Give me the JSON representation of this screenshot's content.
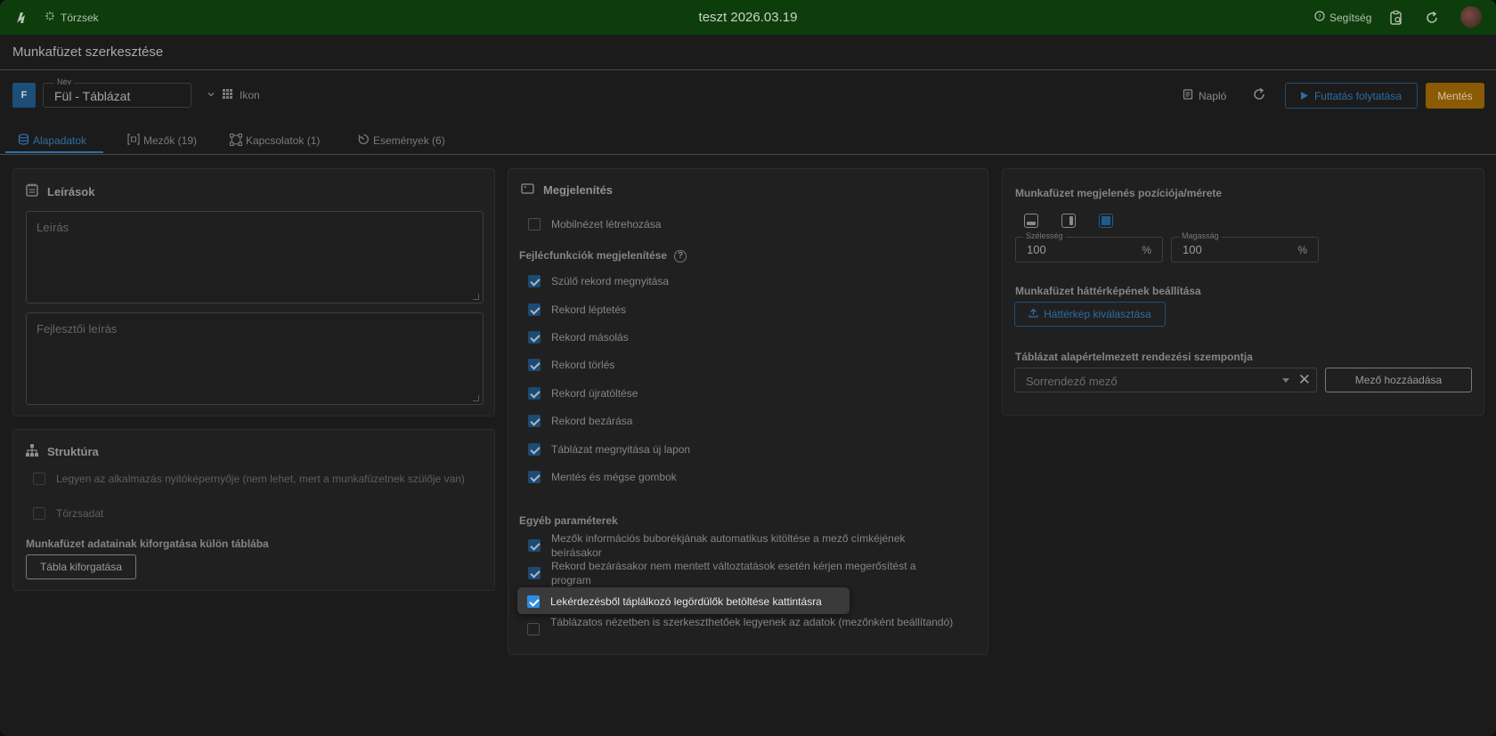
{
  "topbar": {
    "torzsek": "Törzsek",
    "title": "teszt 2026.03.19",
    "help": "Segítség"
  },
  "page": {
    "title": "Munkafüzet szerkesztése"
  },
  "toolbar": {
    "badge": "F",
    "name_label": "Név",
    "name_value": "Fül - Táblázat",
    "ikon": "Ikon",
    "naplo": "Napló",
    "run": "Futtatás folytatása",
    "save": "Mentés"
  },
  "tabs": [
    {
      "label": "Alapadatok",
      "icon": "database-icon"
    },
    {
      "label": "Mezők (19)",
      "icon": "fields-icon"
    },
    {
      "label": "Kapcsolatok (1)",
      "icon": "relations-icon"
    },
    {
      "label": "Események (6)",
      "icon": "events-icon"
    }
  ],
  "leirasok": {
    "title": "Leírások",
    "desc_placeholder": "Leírás",
    "dev_placeholder": "Fejlesztői leírás"
  },
  "struktura": {
    "title": "Struktúra",
    "items": [
      {
        "label": "Legyen az alkalmazás nyitóképernyője (nem lehet, mert a munkafüzetnek szülője van)",
        "checked": false
      },
      {
        "label": "Törzsadat",
        "checked": false
      }
    ],
    "pivot_heading": "Munkafüzet adatainak kiforgatása külön táblába",
    "pivot_button": "Tábla kiforgatása"
  },
  "megjelenites": {
    "title": "Megjelenítés",
    "mobile": {
      "label": "Mobilnézet létrehozása",
      "checked": false
    },
    "header_funcs_heading": "Fejlécfunkciók megjelenítése",
    "header_funcs": [
      {
        "label": "Szülő rekord megnyitása",
        "checked": true
      },
      {
        "label": "Rekord léptetés",
        "checked": true
      },
      {
        "label": "Rekord másolás",
        "checked": true
      },
      {
        "label": "Rekord törlés",
        "checked": true
      },
      {
        "label": "Rekord újratöltése",
        "checked": true
      },
      {
        "label": "Rekord bezárása",
        "checked": true
      },
      {
        "label": "Táblázat megnyitása új lapon",
        "checked": true
      },
      {
        "label": "Mentés és mégse gombok",
        "checked": true
      }
    ],
    "other_heading": "Egyéb paraméterek",
    "other": [
      {
        "label": "Mezők információs buborékjának automatikus kitöltése a mező címkéjének beírásakor",
        "checked": true
      },
      {
        "label": "Rekord bezárásakor nem mentett változtatások esetén kérjen megerősítést a program",
        "checked": true
      },
      {
        "label": "Lekérdezésből táplálkozó legördülők betöltése kattintásra",
        "checked": true
      },
      {
        "label": "Táblázatos nézetben is szerkeszthetőek legyenek az adatok (mezőnként beállítandó)",
        "checked": false
      }
    ]
  },
  "position": {
    "heading": "Munkafüzet megjelenés pozíciója/mérete",
    "width_label": "Szélesség",
    "width_value": "100",
    "height_label": "Magasság",
    "height_value": "100",
    "unit": "%",
    "bg_heading": "Munkafüzet háttérképének beállítása",
    "bg_button": "Háttérkép kiválasztása",
    "sort_heading": "Táblázat alapértelmezett rendezési szempontja",
    "sort_placeholder": "Sorrendező mező",
    "add_field": "Mező hozzáadása"
  }
}
